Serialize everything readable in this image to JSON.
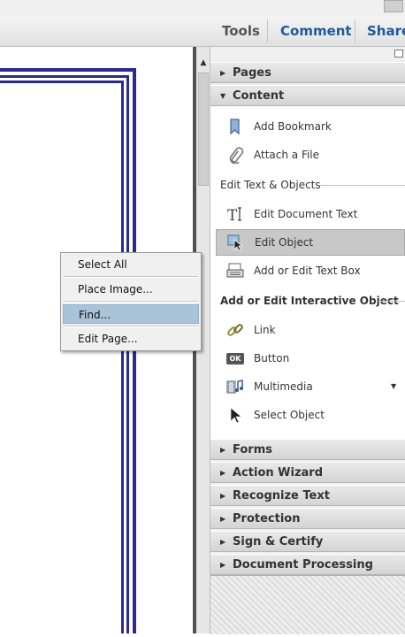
{
  "toolbar": {
    "tools": "Tools",
    "comment": "Comment",
    "share": "Share",
    "accent": "#1e5a9c"
  },
  "panel": {
    "pages": "Pages",
    "content": "Content",
    "content_items": {
      "add_bookmark": "Add Bookmark",
      "attach_file": "Attach a File"
    },
    "edit_text_section": "Edit Text & Objects",
    "edit_items": {
      "edit_document_text": "Edit Document Text",
      "edit_object": "Edit Object",
      "add_edit_text_box": "Add or Edit Text Box"
    },
    "interactive_section": "Add or Edit Interactive Object",
    "interactive_items": {
      "link": "Link",
      "button": "Button",
      "button_icon_text": "OK",
      "multimedia": "Multimedia",
      "select_object": "Select Object"
    },
    "collapsed": {
      "forms": "Forms",
      "action_wizard": "Action Wizard",
      "recognize_text": "Recognize Text",
      "protection": "Protection",
      "sign_certify": "Sign & Certify",
      "document_processing": "Document Processing"
    }
  },
  "context_menu": {
    "select_all": "Select All",
    "place_image": "Place Image...",
    "find": "Find...",
    "edit_page": "Edit Page..."
  },
  "colors": {
    "page_border": "#2b2b8f",
    "menu_highlight": "#a9c3d9",
    "selected_item": "#c8c8c8"
  },
  "icons": {
    "bookmark": "bookmark-icon",
    "attach": "paperclip-icon",
    "edit_text": "text-cursor-icon",
    "edit_object": "object-cursor-icon",
    "text_box": "text-box-icon",
    "link": "chain-link-icon",
    "button": "ok-button-icon",
    "multimedia": "film-music-icon",
    "select_object": "arrow-pointer-icon"
  }
}
